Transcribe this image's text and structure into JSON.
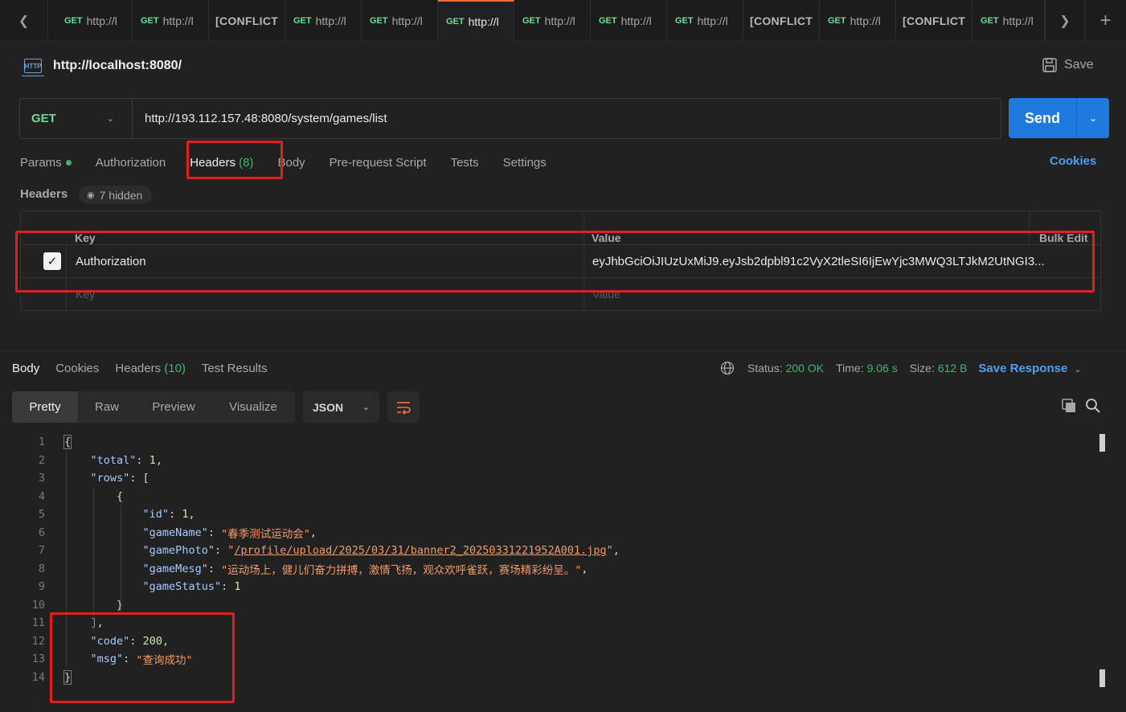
{
  "tabs": [
    {
      "method": "GET",
      "url": "http://l",
      "conflict": false,
      "active": false
    },
    {
      "method": "GET",
      "url": "http://l",
      "conflict": false,
      "active": false
    },
    {
      "method": "",
      "url": "[CONFLICT",
      "conflict": true,
      "active": false
    },
    {
      "method": "GET",
      "url": "http://l",
      "conflict": false,
      "active": false
    },
    {
      "method": "GET",
      "url": "http://l",
      "conflict": false,
      "active": false
    },
    {
      "method": "GET",
      "url": "http://l",
      "conflict": false,
      "active": true
    },
    {
      "method": "GET",
      "url": "http://l",
      "conflict": false,
      "active": false
    },
    {
      "method": "GET",
      "url": "http://l",
      "conflict": false,
      "active": false
    },
    {
      "method": "GET",
      "url": "http://l",
      "conflict": false,
      "active": false
    },
    {
      "method": "",
      "url": "[CONFLICT",
      "conflict": true,
      "active": false
    },
    {
      "method": "GET",
      "url": "http://l",
      "conflict": false,
      "active": false
    },
    {
      "method": "",
      "url": "[CONFLICT",
      "conflict": true,
      "active": false
    },
    {
      "method": "GET",
      "url": "http://l",
      "conflict": false,
      "active": false
    }
  ],
  "request": {
    "icon": "http-icon",
    "name": "http://localhost:8080/",
    "save_label": "Save",
    "method": "GET",
    "url": "http://193.112.157.48:8080/system/games/list",
    "send_label": "Send",
    "cookies_label": "Cookies"
  },
  "request_tabs": {
    "params": "Params",
    "authorization": "Authorization",
    "headers": "Headers",
    "headers_count": "(8)",
    "body": "Body",
    "prerequest": "Pre-request Script",
    "tests": "Tests",
    "settings": "Settings"
  },
  "headers_section": {
    "title": "Headers",
    "hidden_label": "7 hidden",
    "col_key": "Key",
    "col_value": "Value",
    "bulk_edit": "Bulk Edit",
    "row": {
      "checked": true,
      "key": "Authorization",
      "value": "eyJhbGciOiJIUzUxMiJ9.eyJsb2dpbl91c2VyX2tleSI6IjEwYjc3MWQ3LTJkM2UtNGI3..."
    },
    "placeholder_key": "Key",
    "placeholder_value": "Value"
  },
  "response": {
    "tabs": {
      "body": "Body",
      "cookies": "Cookies",
      "headers": "Headers",
      "headers_count": "(10)",
      "tests": "Test Results"
    },
    "status_label": "Status:",
    "status_value": "200 OK",
    "time_label": "Time:",
    "time_value": "9.06 s",
    "size_label": "Size:",
    "size_value": "612 B",
    "save_response": "Save Response",
    "views": [
      "Pretty",
      "Raw",
      "Preview",
      "Visualize"
    ],
    "format": "JSON"
  },
  "code": {
    "line_numbers": [
      "1",
      "2",
      "3",
      "4",
      "5",
      "6",
      "7",
      "8",
      "9",
      "10",
      "11",
      "12",
      "13",
      "14"
    ],
    "k_total": "\"total\"",
    "v_total": "1",
    "k_rows": "\"rows\"",
    "k_id": "\"id\"",
    "v_id": "1",
    "k_gameName": "\"gameName\"",
    "v_gameName": "\"春季测试运动会\"",
    "k_gamePhoto": "\"gamePhoto\"",
    "v_gamePhoto": "/profile/upload/2025/03/31/banner2_20250331221952A001.jpg",
    "k_gameMesg": "\"gameMesg\"",
    "v_gameMesg": "\"运动场上，健儿们奋力拼搏，激情飞扬，观众欢呼雀跃，赛场精彩纷呈。\"",
    "k_gameStatus": "\"gameStatus\"",
    "v_gameStatus": "1",
    "k_code": "\"code\"",
    "v_code": "200",
    "k_msg": "\"msg\"",
    "v_msg": "\"查询成功\""
  },
  "colors": {
    "accent": "#ff6c37",
    "send": "#1f7ae0",
    "get_method": "#6bdd9a",
    "success": "#3bb86b",
    "highlight_box": "#e02020"
  }
}
